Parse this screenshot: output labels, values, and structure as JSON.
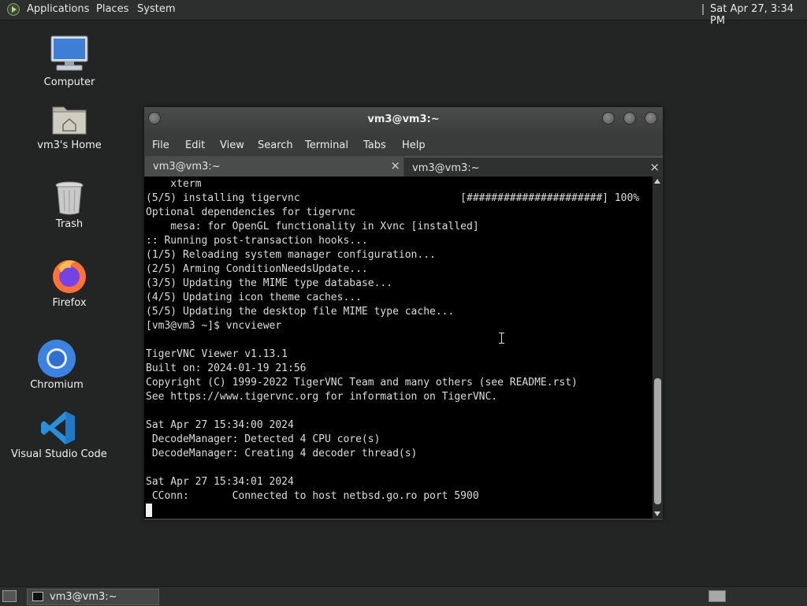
{
  "top_panel": {
    "menus": [
      "Applications",
      "Places",
      "System"
    ],
    "clock": "Sat Apr 27,  3:34 PM"
  },
  "desktop_icons": [
    {
      "label": "Computer",
      "icon": "computer-icon"
    },
    {
      "label": "vm3's Home",
      "icon": "home-folder-icon"
    },
    {
      "label": "Trash",
      "icon": "trash-icon"
    },
    {
      "label": "Firefox",
      "icon": "firefox-icon"
    },
    {
      "label": "Chromium",
      "icon": "chromium-icon"
    },
    {
      "label": "Visual Studio Code",
      "icon": "vscode-icon"
    }
  ],
  "terminal": {
    "title": "vm3@vm3:~",
    "menu": [
      "File",
      "Edit",
      "View",
      "Search",
      "Terminal",
      "Tabs",
      "Help"
    ],
    "tabs": [
      {
        "label": "vm3@vm3:~",
        "close": "×"
      },
      {
        "label": "vm3@vm3:~",
        "close": "×"
      }
    ],
    "lines": [
      "    xterm",
      "(5/5) installing tigervnc                          [######################] 100%",
      "Optional dependencies for tigervnc",
      "    mesa: for OpenGL functionality in Xvnc [installed]",
      ":: Running post-transaction hooks...",
      "(1/5) Reloading system manager configuration...",
      "(2/5) Arming ConditionNeedsUpdate...",
      "(3/5) Updating the MIME type database...",
      "(4/5) Updating icon theme caches...",
      "(5/5) Updating the desktop file MIME type cache...",
      "[vm3@vm3 ~]$ vncviewer",
      "",
      "TigerVNC Viewer v1.13.1",
      "Built on: 2024-01-19 21:56",
      "Copyright (C) 1999-2022 TigerVNC Team and many others (see README.rst)",
      "See https://www.tigervnc.org for information on TigerVNC.",
      "",
      "Sat Apr 27 15:34:00 2024",
      " DecodeManager: Detected 4 CPU core(s)",
      " DecodeManager: Creating 4 decoder thread(s)",
      "",
      "Sat Apr 27 15:34:01 2024",
      " CConn:       Connected to host netbsd.go.ro port 5900"
    ]
  },
  "taskbar": {
    "window_label": "vm3@vm3:~"
  },
  "colors": {
    "desktop_bg": "#232524",
    "panel_bg": "#2d2f2e",
    "terminal_bg": "#000000",
    "terminal_fg": "#dcdcdc"
  }
}
